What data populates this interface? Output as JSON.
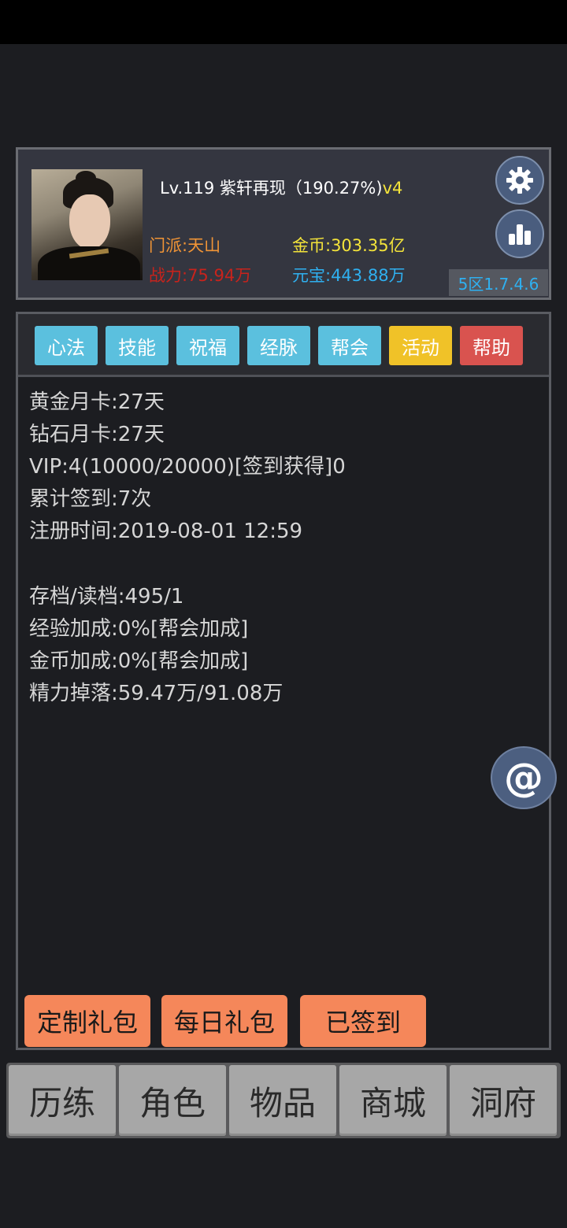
{
  "profile": {
    "level_name": "Lv.119 紫轩再现（190.27%)",
    "vip_tag": "v4",
    "sect": "门派:天山",
    "gold": "金币:303.35亿",
    "power": "战力:75.94万",
    "yuanbao": "元宝:443.88万",
    "server_version": "5区1.7.4.6"
  },
  "tabs": [
    {
      "label": "心法",
      "color": "#5bc0de"
    },
    {
      "label": "技能",
      "color": "#5bc0de"
    },
    {
      "label": "祝福",
      "color": "#5bc0de"
    },
    {
      "label": "经脉",
      "color": "#5bc0de"
    },
    {
      "label": "帮会",
      "color": "#5bc0de"
    },
    {
      "label": "活动",
      "color": "#f0c228"
    },
    {
      "label": "帮助",
      "color": "#d9534f"
    }
  ],
  "info": {
    "gold_card": "黄金月卡:27天",
    "diamond_card": "钻石月卡:27天",
    "vip": "VIP:4(10000/20000)[签到获得]0",
    "checkin_total": "累计签到:7次",
    "register_time": "注册时间:2019-08-01 12:59",
    "save_load": "存档/读档:495/1",
    "exp_bonus": "经验加成:0%[帮会加成]",
    "gold_bonus": "金币加成:0%[帮会加成]",
    "energy_drop": "精力掉落:59.47万/91.08万"
  },
  "actions": {
    "custom_pack": "定制礼包",
    "daily_pack": "每日礼包",
    "checked_in": "已签到"
  },
  "at_symbol": "@",
  "nav": [
    "历练",
    "角色",
    "物品",
    "商城",
    "洞府"
  ],
  "icons": {
    "settings": "gear-icon",
    "stats": "bar-chart-icon",
    "mention": "at-icon"
  }
}
